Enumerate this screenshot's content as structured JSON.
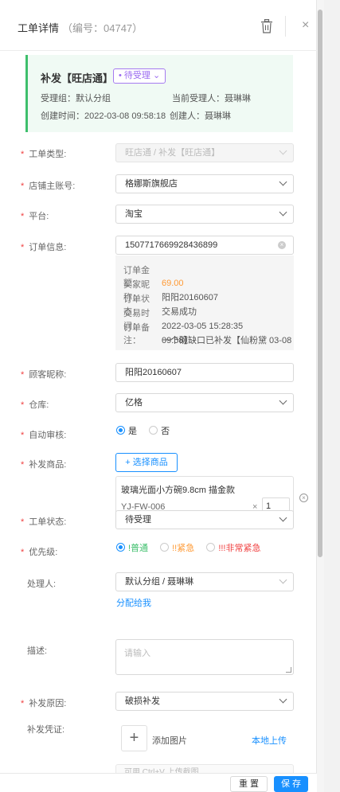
{
  "header": {
    "title": "工单详情",
    "number": "（编号：04747）"
  },
  "summary": {
    "title": "补发【旺店通】",
    "status": "• 待受理 ⌄",
    "group_line": "受理组：默认分组",
    "handler_line": "当前受理人：聂琳琳",
    "created_line": "创建时间：2022-03-08 09:58:18",
    "creator_line": "创建人：聂琳琳"
  },
  "fields": {
    "ticket_type": {
      "label": "工单类型:",
      "value": "旺店通 / 补发【旺店通】"
    },
    "shop_account": {
      "label": "店铺主账号:",
      "value": "格娜斯旗舰店"
    },
    "platform": {
      "label": "平台:",
      "value": "淘宝"
    },
    "order": {
      "label": "订单信息:",
      "value": "1507717669928436899",
      "amount_label": "订单金额：",
      "amount": "69.00",
      "buyer_label": "买家昵称：",
      "buyer": "阳阳20160607",
      "status_label": "订单状态：",
      "status": "交易成功",
      "time_label": "交易时间：",
      "time": "2022-03-05 15:28:35",
      "note_label": "订单备注：",
      "note_line1": "一个碗缺口已补发【仙粉黛 03-08",
      "note_line2": "09:58】"
    },
    "customer_nick": {
      "label": "顾客昵称:",
      "value": "阳阳20160607"
    },
    "warehouse": {
      "label": "仓库:",
      "value": "亿格"
    },
    "auto_review": {
      "label": "自动审核:",
      "yes": "是",
      "no": "否"
    },
    "reissue_goods": {
      "label": "补发商品:",
      "button": "+ 选择商品",
      "product_name": "玻璃光面小方碗9.8cm 描金款",
      "product_sku": "YJ-FW-006",
      "times": "×",
      "qty": "1"
    },
    "ticket_status": {
      "label": "工单状态:",
      "value": "待受理"
    },
    "priority": {
      "label": "优先级:",
      "normal": "!普通",
      "urgent": "!!紧急",
      "very_urgent": "!!!非常紧急"
    },
    "handler": {
      "label": "处理人:",
      "value": "默认分组 / 聂琳琳",
      "assign_link": "分配给我"
    },
    "description": {
      "label": "描述:",
      "placeholder": "请输入"
    },
    "reissue_reason": {
      "label": "补发原因:",
      "value": "破损补发"
    },
    "voucher": {
      "label": "补发凭证:",
      "add_image": "添加图片",
      "local_upload": "本地上传",
      "paste_hint": "可用 Ctrl+V 上传截图"
    }
  },
  "footer": {
    "reset": "重 置",
    "save": "保 存"
  },
  "colors": {
    "accent": "#1890ff",
    "success": "#3ebf6c",
    "warning": "#ff9933",
    "danger": "#f04141",
    "status_tag": "#9a6af0"
  }
}
